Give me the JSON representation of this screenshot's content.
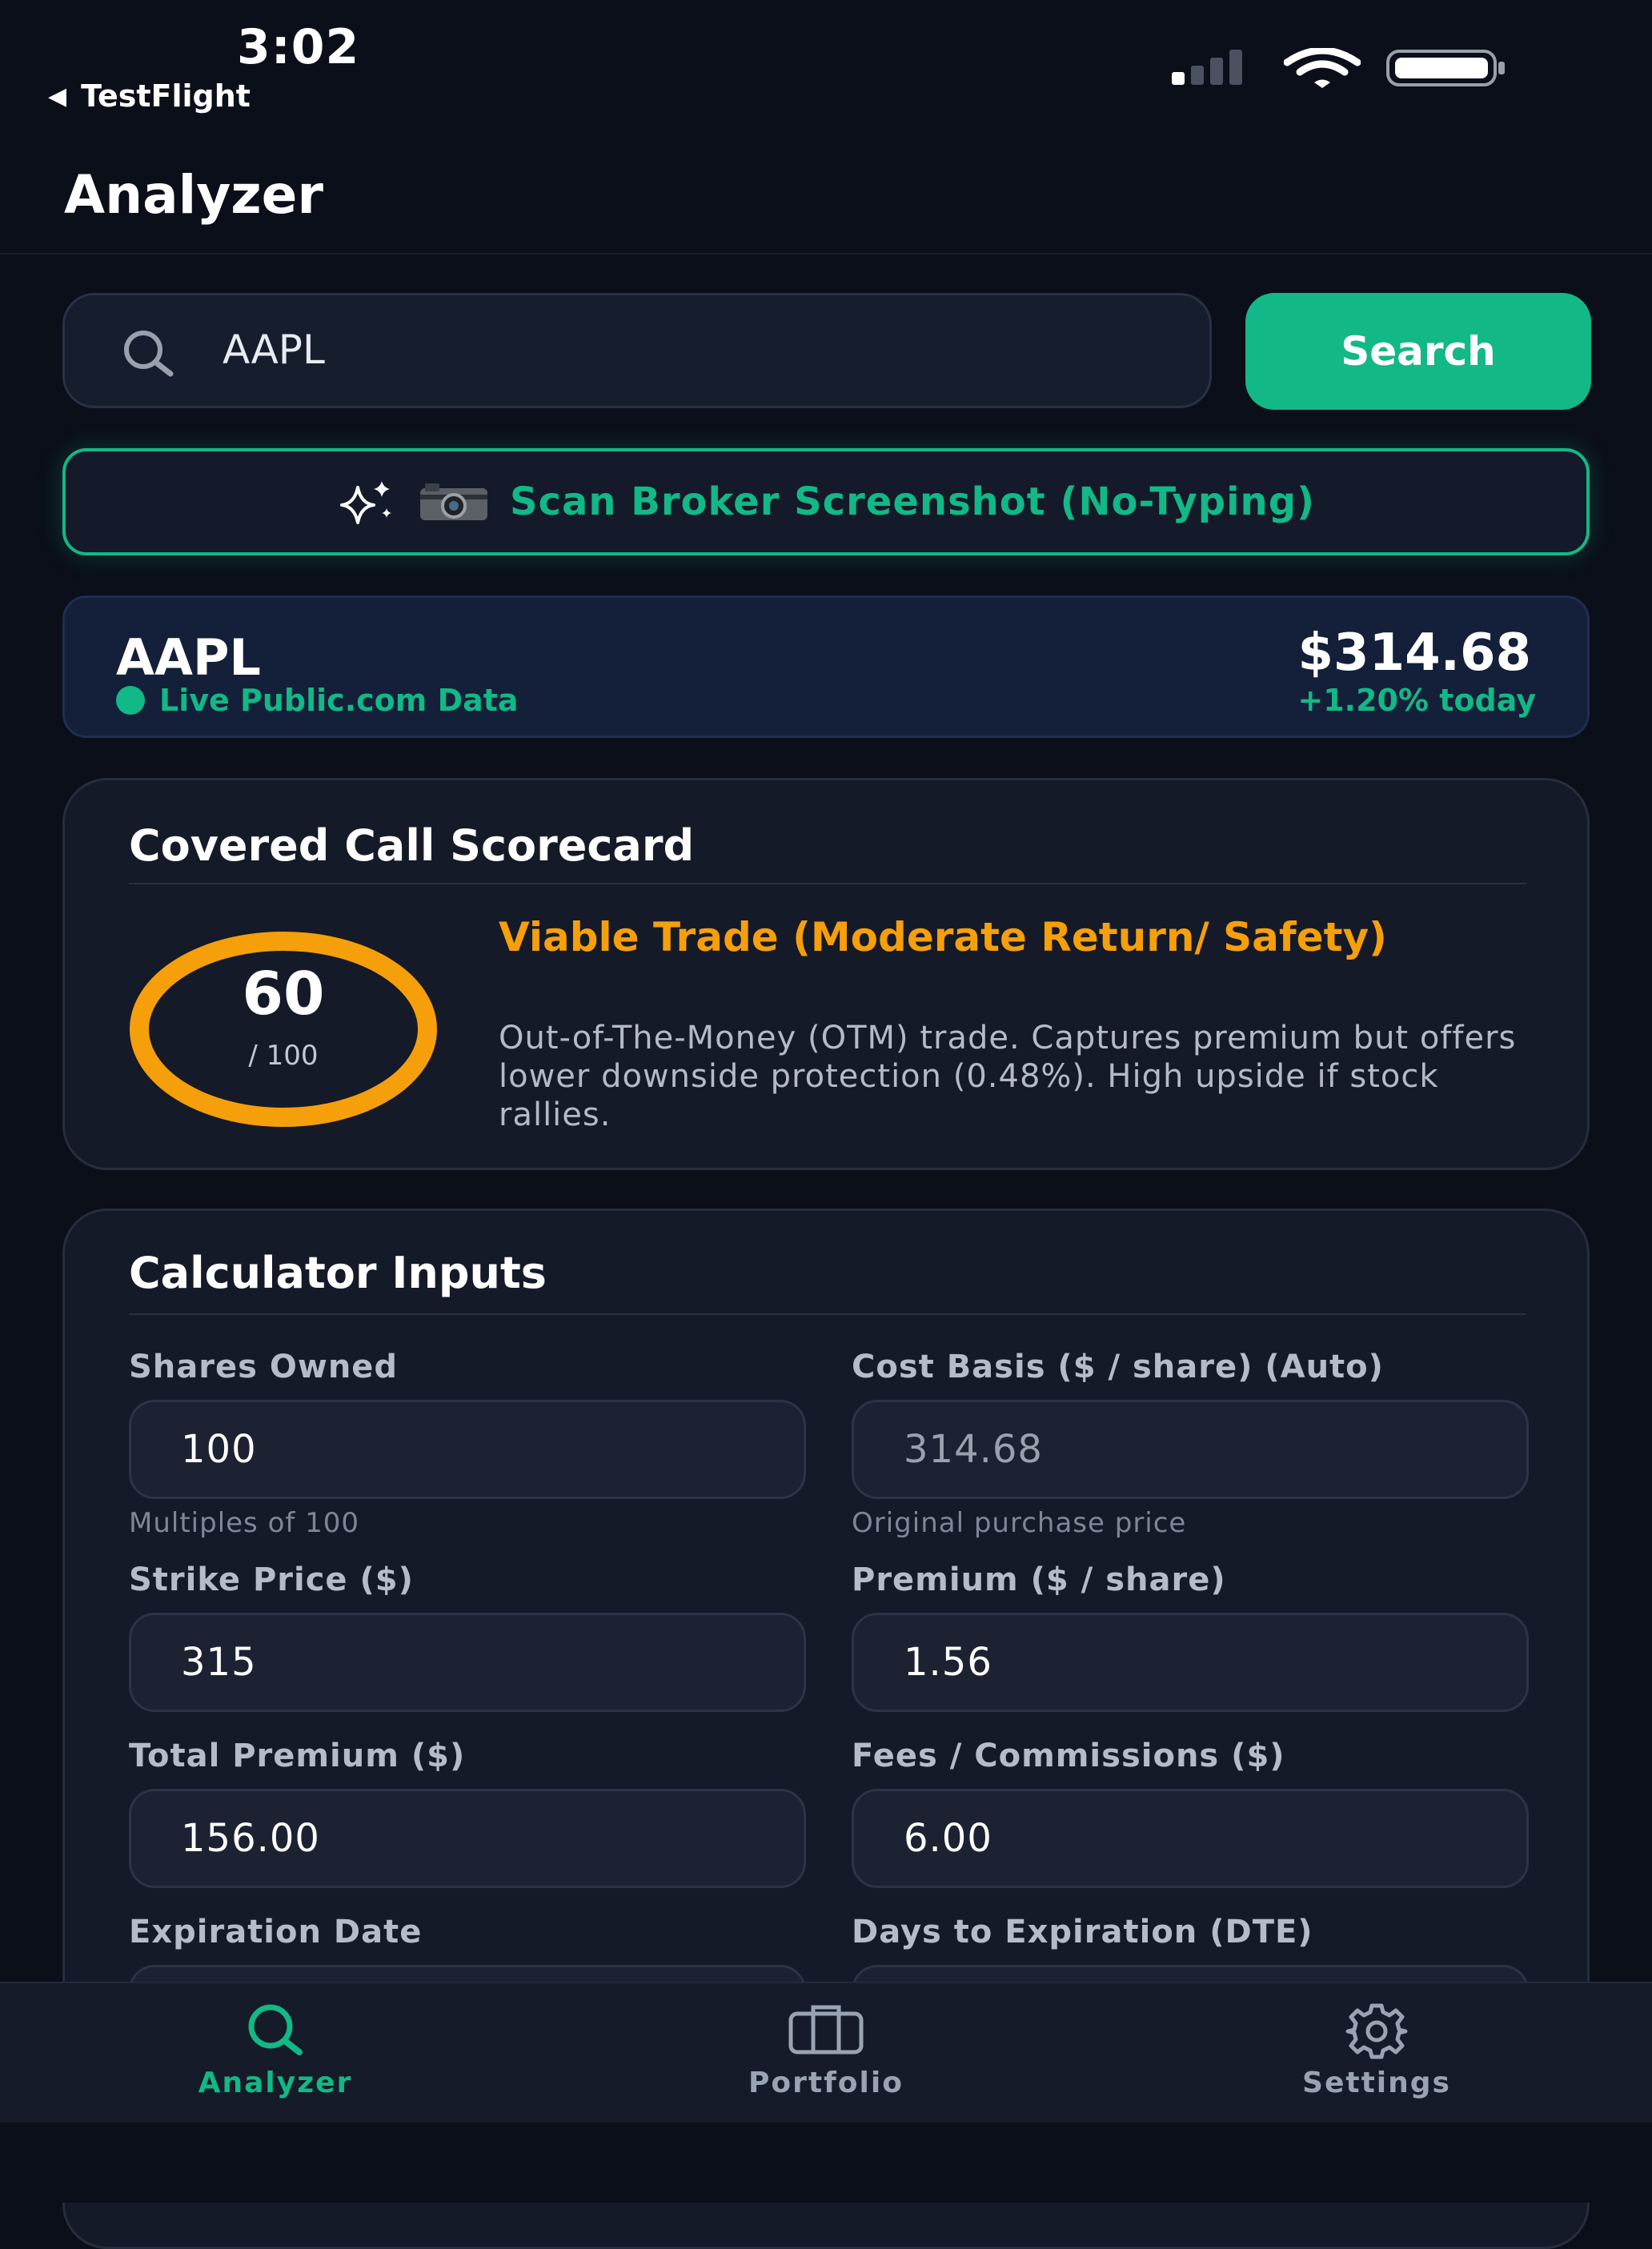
{
  "status_bar": {
    "time": "3:02",
    "back_label": "TestFlight"
  },
  "header": {
    "title": "Analyzer"
  },
  "search": {
    "value": "AAPL",
    "button_label": "Search"
  },
  "scan": {
    "label": "Scan Broker Screenshot (No-Typing)",
    "icons": [
      "sparkles-icon",
      "camera-icon"
    ]
  },
  "ticker": {
    "symbol": "AAPL",
    "source": "Live Public.com Data",
    "price": "$314.68",
    "change": "+1.20% today"
  },
  "scorecard": {
    "title": "Covered Call Scorecard",
    "score": "60",
    "max": "/ 100",
    "score_fraction": 0.6,
    "verdict": "Viable Trade (Moderate Return/ Safety)",
    "description": "Out-of-The-Money (OTM) trade. Captures premium but offers lower downside protection (0.48%). High upside if stock rallies."
  },
  "calculator": {
    "title": "Calculator Inputs",
    "shares_label": "Shares Owned",
    "shares_value": "100",
    "shares_hint": "Multiples of 100",
    "cost_label": "Cost Basis ($ / share) (Auto)",
    "cost_value": "314.68",
    "cost_hint": "Original purchase price",
    "strike_label": "Strike Price ($)",
    "strike_value": "315",
    "premium_label": "Premium ($ / share)",
    "premium_value": "1.56",
    "total_label": "Total Premium ($)",
    "total_value": "156.00",
    "fees_label": "Fees / Commissions ($)",
    "fees_value": "6.00",
    "expiration_label": "Expiration Date",
    "dte_label": "Days to Expiration (DTE)"
  },
  "tabs": [
    {
      "label": "Analyzer",
      "icon": "search-icon",
      "active": true
    },
    {
      "label": "Portfolio",
      "icon": "briefcase-icon",
      "active": false
    },
    {
      "label": "Settings",
      "icon": "gear-icon",
      "active": false
    }
  ],
  "colors": {
    "background": "#0b0f1a",
    "accent": "#12b886",
    "warning": "#f59f0a",
    "card": "#151a28"
  }
}
